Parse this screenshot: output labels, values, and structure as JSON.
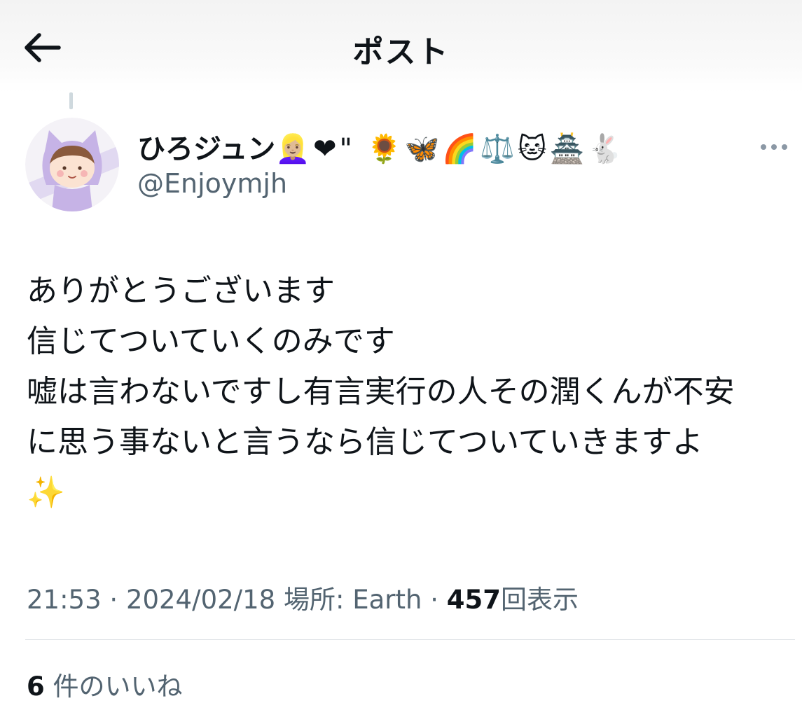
{
  "header": {
    "title": "ポスト",
    "back_icon": "back-arrow-icon"
  },
  "author": {
    "display_name": "ひろジュン",
    "name_emojis": "👱🏼‍♀️❤\" 🌻🦋🌈⚖️🐱🏯🐇",
    "handle": "@Enjoymjh"
  },
  "post": {
    "text": "ありがとうございます\n信じてついていくのみです\n嘘は言わないですし有言実行の人その潤くんが不安\nに思う事ないと言うなら信じてついていきますよ\n✨",
    "time": "21:53",
    "sep1": "·",
    "date": "2024/02/18",
    "location_label": "場所: Earth",
    "sep2": "·",
    "views_count": "457",
    "views_label": "回表示"
  },
  "engagement": {
    "likes_count": "6",
    "likes_label": "件のいいね"
  },
  "colors": {
    "secondary_text": "#536471",
    "primary_text": "#0f1419",
    "divider": "#dfe3e6"
  }
}
